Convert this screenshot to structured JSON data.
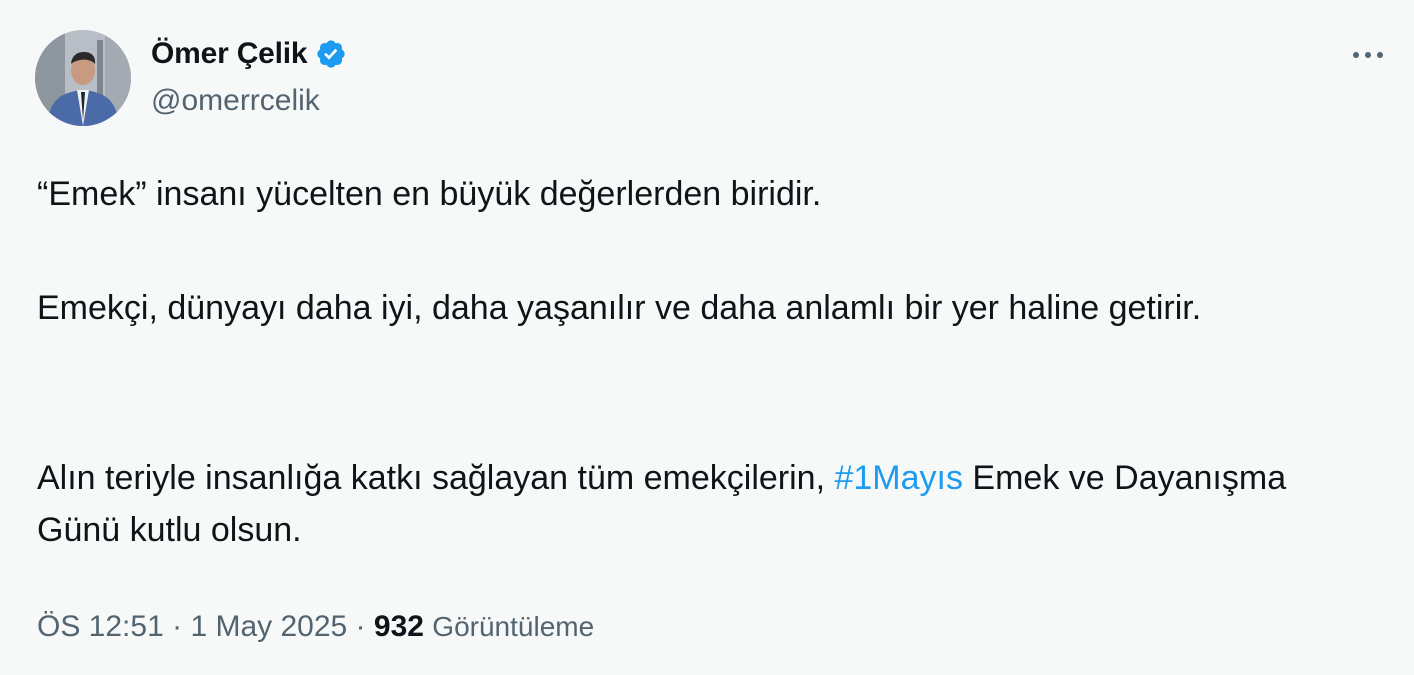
{
  "author": {
    "display_name": "Ömer Çelik",
    "handle": "@omerrcelik",
    "verified": true,
    "avatar_icon": "profile-photo"
  },
  "more_icon": "more-horizontal-icon",
  "tweet": {
    "paragraph_1": "“Emek” insanı yücelten en büyük değerlerden biridir.",
    "paragraph_2": "Emekçi, dünyayı daha iyi, daha yaşanılır ve daha anlamlı bir yer haline getirir.",
    "paragraph_3_before": "Alın teriyle insanlığa katkı sağlayan tüm emekçilerin, ",
    "hashtag": "#1Mayıs",
    "paragraph_3_after": " Emek ve Dayanışma Günü kutlu olsun."
  },
  "meta": {
    "time": "ÖS 12:51",
    "separator": " · ",
    "date": "1 May 2025",
    "views_count": "932",
    "views_label": "Görüntüleme"
  },
  "colors": {
    "background": "#f7f9f9",
    "text": "#0f1419",
    "secondary": "#536471",
    "accent": "#1d9bf0"
  }
}
